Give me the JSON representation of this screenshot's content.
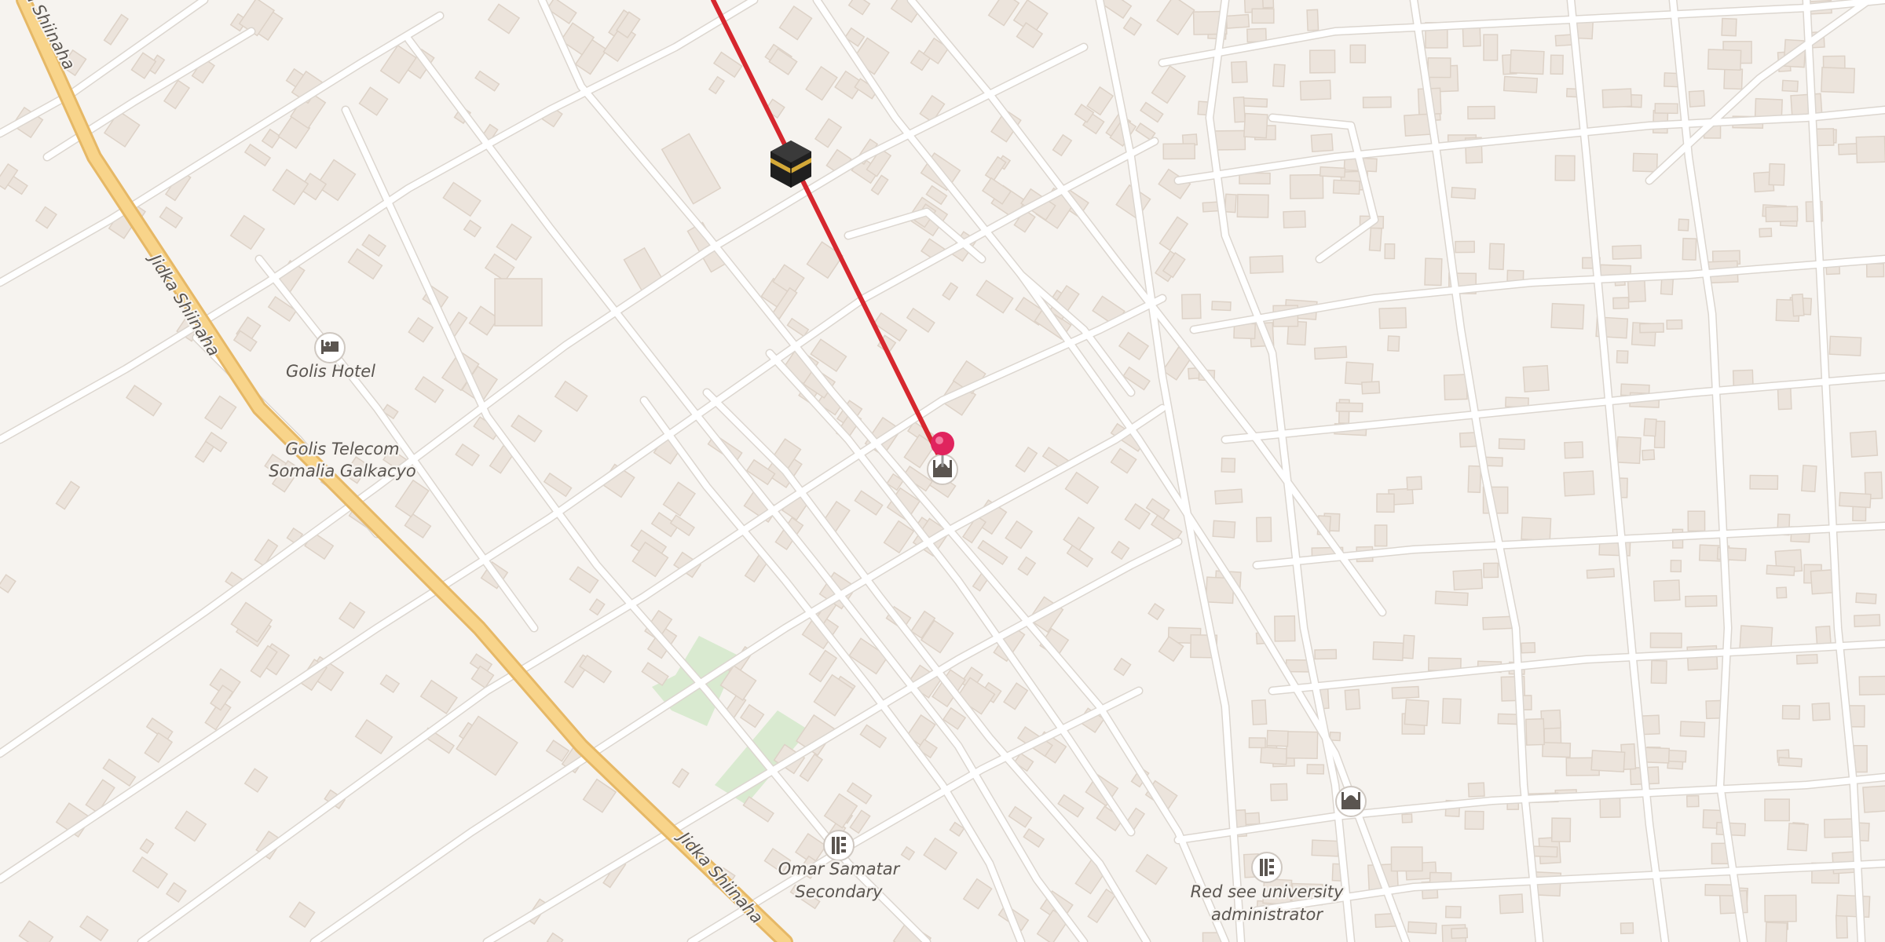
{
  "map": {
    "colors": {
      "background": "#f6f3ef",
      "street": "#ffffff",
      "street_casing": "#dcd6cf",
      "building": "#ece4dc",
      "main_road": "#f8d48a",
      "main_road_casing": "#e6b866",
      "park": "#d9ead0",
      "qibla_line": "#d6272e",
      "pin": "#e0245e"
    },
    "road_labels": {
      "jidka_top": "Jidka Shiinaha",
      "jidka_bottom": "Jidka Shiinaha"
    },
    "pois": {
      "golis_hotel": {
        "name": "Golis Hotel",
        "icon": "hotel-icon"
      },
      "golis_telecom": {
        "line1": "Golis Telecom",
        "line2": "Somalia Galkacyo"
      },
      "omar_samatar": {
        "line1": "Omar Samatar",
        "line2": "Secondary",
        "icon": "school-icon"
      },
      "red_see": {
        "line1": "Red see university",
        "line2": "administrator",
        "icon": "university-icon"
      },
      "mosque_center": {
        "icon": "mosque-icon"
      },
      "mosque_right": {
        "icon": "mosque-icon"
      }
    },
    "qibla": {
      "icon": "kaaba-icon"
    },
    "marker": {
      "icon": "location-pin-icon"
    }
  }
}
